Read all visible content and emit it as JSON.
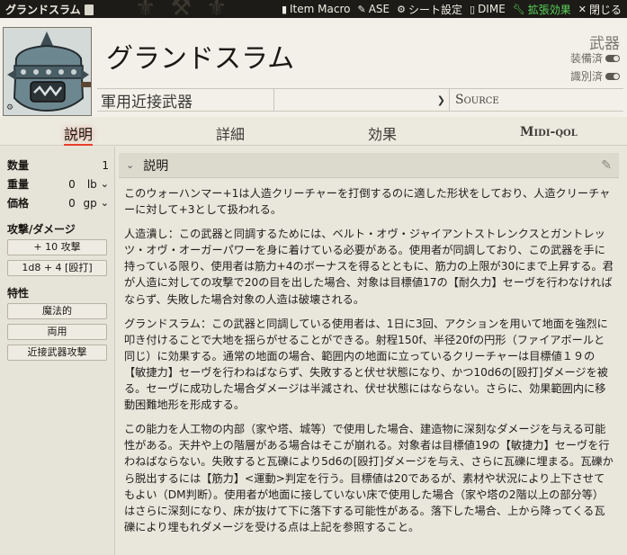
{
  "window": {
    "title": "グランドスラム",
    "actions": [
      {
        "icon": "file-icon",
        "label": "Item Macro"
      },
      {
        "icon": "pencil-icon",
        "label": "ASE"
      },
      {
        "icon": "gear-icon",
        "label": "シート設定"
      },
      {
        "icon": "file-icon",
        "label": "DIME"
      },
      {
        "icon": "wrench-icon",
        "label": "拡張効果"
      },
      {
        "icon": "close-icon",
        "label": "閉じる"
      }
    ]
  },
  "header": {
    "name": "グランドスラム",
    "item_type": "武器",
    "toggle_equipped": "装備済",
    "toggle_identified": "識別済",
    "subtype": "軍用近接武器",
    "source": "Source"
  },
  "tabs": [
    {
      "label": "説明",
      "active": true
    },
    {
      "label": "詳細",
      "active": false
    },
    {
      "label": "効果",
      "active": false
    },
    {
      "label": "Midi-qol",
      "active": false
    }
  ],
  "sidebar": {
    "quantity_label": "数量",
    "quantity": "1",
    "weight_label": "重量",
    "weight": "0",
    "weight_unit": "lb",
    "price_label": "価格",
    "price": "0",
    "price_unit": "gp",
    "attack_heading": "攻撃/ダメージ",
    "attack_bonus": "+ 10 攻撃",
    "damage": "1d8 + 4 [殴打]",
    "properties_heading": "特性",
    "properties": [
      "魔法的",
      "両用",
      "近接武器攻撃"
    ]
  },
  "description": {
    "heading": "説明",
    "paragraphs": [
      "このウォーハンマー+1は人造クリーチャーを打倒するのに適した形状をしており、人造クリーチャーに対して+3として扱われる。",
      "人造潰し：この武器と同調するためには、ベルト・オヴ・ジャイアントストレンクスとガントレッツ・オヴ・オーガーパワーを身に着けている必要がある。使用者が同調しており、この武器を手に持っている限り、使用者は筋力+4のボーナスを得るとともに、筋力の上限が30にまで上昇する。君が人造に対しての攻撃で20の目を出した場合、対象は目標値17の【耐久力】セーヴを行わなければならず、失敗した場合対象の人造は破壊される。",
      "グランドスラム：この武器と同調している使用者は、1日に3回、アクションを用いて地面を強烈に叩き付けることで大地を揺らがせることができる。射程150f、半径20fの円形（ファイアボールと同じ）に効果する。通常の地面の場合、範囲内の地面に立っているクリーチャーは目標値１９の【敏捷力】セーヴを行わねばならず、失敗すると伏せ状態になり、かつ10d6の[殴打]ダメージを被る。セーヴに成功した場合ダメージは半減され、伏せ状態にはならない。さらに、効果範囲内に移動困難地形を形成する。",
      "この能力を人工物の内部（家や塔、城等）で使用した場合、建造物に深刻なダメージを与える可能性がある。天井や上の階層がある場合はそこが崩れる。対象者は目標値19の【敏捷力】セーヴを行わねばならない。失敗すると瓦礫により5d6の[殴打]ダメージを与え、さらに瓦礫に埋まる。瓦礫から脱出するには【筋力】<運動>判定を行う。目標値は20であるが、素材や状況により上下させてもよい（DM判断）。使用者が地面に接していない床で使用した場合（家や塔の2階以上の部分等）はさらに深刻になり、床が抜けて下に落下する可能性がある。落下した場合、上から降ってくる瓦礫により埋もれダメージを受ける点は上記を参照すること。"
    ]
  },
  "colors": {
    "accent": "#e83f2b",
    "green_action": "#5bd35b"
  }
}
